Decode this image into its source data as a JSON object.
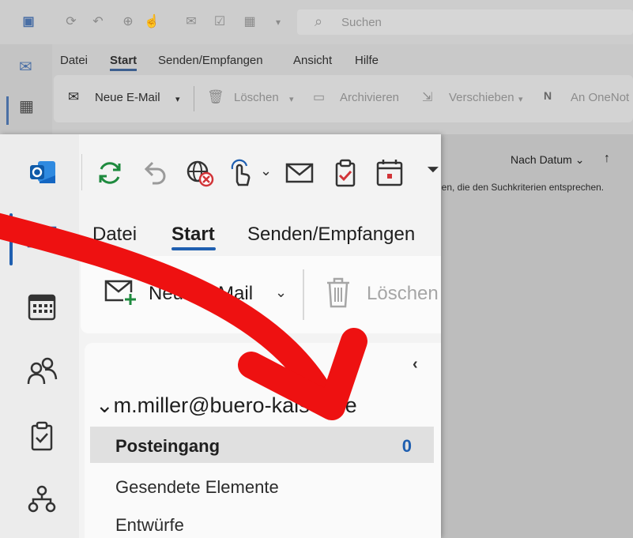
{
  "background_window": {
    "search_placeholder": "Suchen",
    "tabs": [
      "Datei",
      "Start",
      "Senden/Empfangen",
      "Ansicht",
      "Hilfe"
    ],
    "ribbon": {
      "new_mail": "Neue E-Mail",
      "delete": "Löschen",
      "archive": "Archivieren",
      "move": "Verschieben",
      "onenote": "An OneNot"
    },
    "sort_label": "Nach Datum",
    "no_results_text": "len, die den Suchkriterien entsprechen."
  },
  "foreground_window": {
    "tabs": [
      "Datei",
      "Start",
      "Senden/Empfangen"
    ],
    "ribbon": {
      "new_mail": "Neue E-Mail",
      "delete": "Löschen"
    },
    "account": "m.miller@buero-kaiser.de",
    "folders": {
      "inbox": {
        "label": "Posteingang",
        "count": "0"
      },
      "sent": "Gesendete Elemente",
      "drafts": "Entwürfe"
    }
  },
  "colors": {
    "accent": "#1f5fb0",
    "annotation_arrow": "#ee1111"
  },
  "icons": [
    "outlook-logo-icon",
    "sync-icon",
    "undo-icon",
    "globe-blocked-icon",
    "touch-mode-icon",
    "mail-icon",
    "task-icon",
    "calendar-icon",
    "customize-qat-icon",
    "people-icon",
    "org-icon",
    "new-mail-icon",
    "delete-icon",
    "search-icon"
  ]
}
